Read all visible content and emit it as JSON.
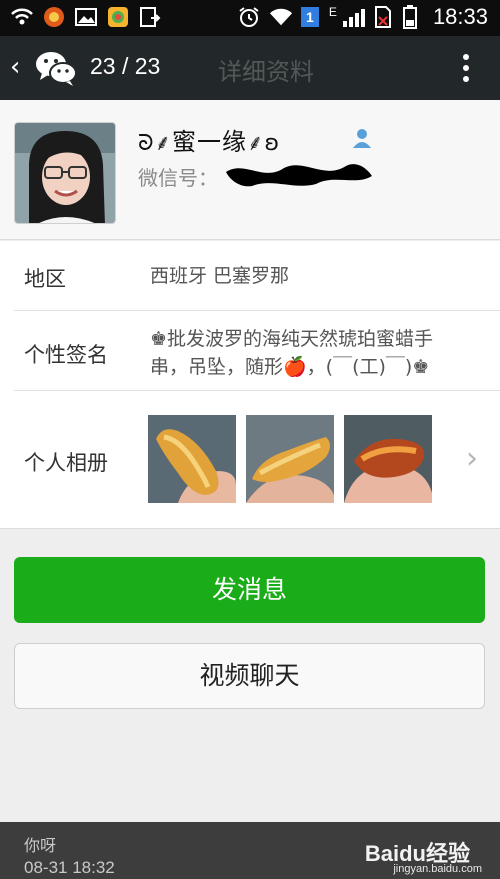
{
  "status_bar": {
    "time": "18:33",
    "network": "E",
    "sim_badge": "1"
  },
  "toolbar": {
    "counter": "23 / 23",
    "title": "详细资料"
  },
  "profile": {
    "nickname": "蜜一缘",
    "wechat_id_label": "微信号："
  },
  "rows": {
    "region_label": "地区",
    "region_value": "西班牙 巴塞罗那",
    "signature_label": "个性签名",
    "signature_line1": "♚批发波罗的海纯天然琥珀蜜蜡手",
    "signature_line2": "串，吊坠，随形🍎，(￣(工)￣)♚",
    "album_label": "个人相册"
  },
  "buttons": {
    "send_message": "发消息",
    "video_chat": "视频聊天"
  },
  "notification": {
    "message": "你呀",
    "time": "08-31   18:32"
  },
  "watermark": {
    "text": "Baidu经验",
    "sub": "jingyan.baidu.com"
  },
  "colors": {
    "accent_green": "#1aad19",
    "toolbar_bg": "#222829"
  }
}
